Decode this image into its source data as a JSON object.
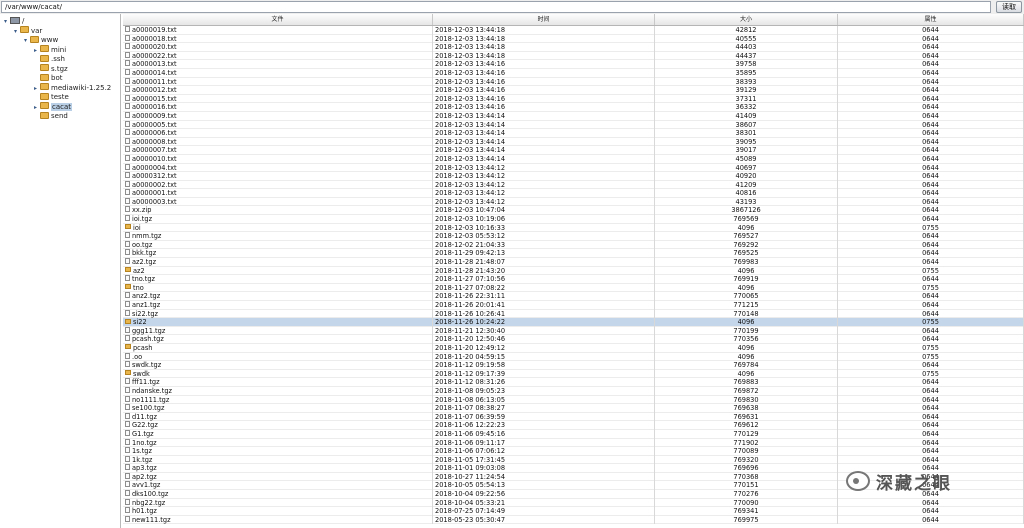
{
  "path_bar": {
    "value": "/var/www/cacat/",
    "read_label": "读取"
  },
  "tree": [
    {
      "label": "/",
      "depth": 0,
      "type": "root",
      "expanded": true
    },
    {
      "label": "var",
      "depth": 1,
      "type": "folder",
      "expanded": true
    },
    {
      "label": "www",
      "depth": 2,
      "type": "folder",
      "expanded": true
    },
    {
      "label": "mini",
      "depth": 3,
      "type": "folder",
      "expanded": false,
      "expandable": true
    },
    {
      "label": ".ssh",
      "depth": 3,
      "type": "folder"
    },
    {
      "label": "s.tgz",
      "depth": 3,
      "type": "folder"
    },
    {
      "label": "bot",
      "depth": 3,
      "type": "folder"
    },
    {
      "label": "mediawiki-1.25.2",
      "depth": 3,
      "type": "folder",
      "expanded": false,
      "expandable": true
    },
    {
      "label": "teste",
      "depth": 3,
      "type": "folder"
    },
    {
      "label": "cacat",
      "depth": 3,
      "type": "folder",
      "expanded": false,
      "expandable": true,
      "selected": true
    },
    {
      "label": "send",
      "depth": 3,
      "type": "folder"
    }
  ],
  "columns": [
    "文件",
    "时间",
    "大小",
    "属性"
  ],
  "files": [
    {
      "name": "a0000019.txt",
      "time": "2018-12-03 13:44:18",
      "size": "42812",
      "perm": "0644",
      "dir": false
    },
    {
      "name": "a0000018.txt",
      "time": "2018-12-03 13:44:18",
      "size": "40555",
      "perm": "0644",
      "dir": false
    },
    {
      "name": "a0000020.txt",
      "time": "2018-12-03 13:44:18",
      "size": "44403",
      "perm": "0644",
      "dir": false
    },
    {
      "name": "a0000022.txt",
      "time": "2018-12-03 13:44:18",
      "size": "44437",
      "perm": "0644",
      "dir": false
    },
    {
      "name": "a0000013.txt",
      "time": "2018-12-03 13:44:16",
      "size": "39758",
      "perm": "0644",
      "dir": false
    },
    {
      "name": "a0000014.txt",
      "time": "2018-12-03 13:44:16",
      "size": "35895",
      "perm": "0644",
      "dir": false
    },
    {
      "name": "a0000011.txt",
      "time": "2018-12-03 13:44:16",
      "size": "38393",
      "perm": "0644",
      "dir": false
    },
    {
      "name": "a0000012.txt",
      "time": "2018-12-03 13:44:16",
      "size": "39129",
      "perm": "0644",
      "dir": false
    },
    {
      "name": "a0000015.txt",
      "time": "2018-12-03 13:44:16",
      "size": "37311",
      "perm": "0644",
      "dir": false
    },
    {
      "name": "a0000016.txt",
      "time": "2018-12-03 13:44:16",
      "size": "36332",
      "perm": "0644",
      "dir": false
    },
    {
      "name": "a0000009.txt",
      "time": "2018-12-03 13:44:14",
      "size": "41409",
      "perm": "0644",
      "dir": false
    },
    {
      "name": "a0000005.txt",
      "time": "2018-12-03 13:44:14",
      "size": "38607",
      "perm": "0644",
      "dir": false
    },
    {
      "name": "a0000006.txt",
      "time": "2018-12-03 13:44:14",
      "size": "38301",
      "perm": "0644",
      "dir": false
    },
    {
      "name": "a0000008.txt",
      "time": "2018-12-03 13:44:14",
      "size": "39095",
      "perm": "0644",
      "dir": false
    },
    {
      "name": "a0000007.txt",
      "time": "2018-12-03 13:44:14",
      "size": "39017",
      "perm": "0644",
      "dir": false
    },
    {
      "name": "a0000010.txt",
      "time": "2018-12-03 13:44:14",
      "size": "45089",
      "perm": "0644",
      "dir": false
    },
    {
      "name": "a0000004.txt",
      "time": "2018-12-03 13:44:12",
      "size": "40697",
      "perm": "0644",
      "dir": false
    },
    {
      "name": "a0000312.txt",
      "time": "2018-12-03 13:44:12",
      "size": "40920",
      "perm": "0644",
      "dir": false
    },
    {
      "name": "a0000002.txt",
      "time": "2018-12-03 13:44:12",
      "size": "41209",
      "perm": "0644",
      "dir": false
    },
    {
      "name": "a0000001.txt",
      "time": "2018-12-03 13:44:12",
      "size": "40816",
      "perm": "0644",
      "dir": false
    },
    {
      "name": "a0000003.txt",
      "time": "2018-12-03 13:44:12",
      "size": "43193",
      "perm": "0644",
      "dir": false
    },
    {
      "name": "xx.zip",
      "time": "2018-12-03 10:47:04",
      "size": "3867126",
      "perm": "0644",
      "dir": false
    },
    {
      "name": "ioi.tgz",
      "time": "2018-12-03 10:19:06",
      "size": "769569",
      "perm": "0644",
      "dir": false
    },
    {
      "name": "ioi",
      "time": "2018-12-03 10:16:33",
      "size": "4096",
      "perm": "0755",
      "dir": true
    },
    {
      "name": "nmm.tgz",
      "time": "2018-12-03 05:53:12",
      "size": "769527",
      "perm": "0644",
      "dir": false
    },
    {
      "name": "oo.tgz",
      "time": "2018-12-02 21:04:33",
      "size": "769292",
      "perm": "0644",
      "dir": false
    },
    {
      "name": "bkk.tgz",
      "time": "2018-11-29 09:42:13",
      "size": "769525",
      "perm": "0644",
      "dir": false
    },
    {
      "name": "az2.tgz",
      "time": "2018-11-28 21:48:07",
      "size": "769983",
      "perm": "0644",
      "dir": false
    },
    {
      "name": "az2",
      "time": "2018-11-28 21:43:20",
      "size": "4096",
      "perm": "0755",
      "dir": true
    },
    {
      "name": "tno.tgz",
      "time": "2018-11-27 07:10:56",
      "size": "769919",
      "perm": "0644",
      "dir": false
    },
    {
      "name": "tno",
      "time": "2018-11-27 07:08:22",
      "size": "4096",
      "perm": "0755",
      "dir": true
    },
    {
      "name": "anz2.tgz",
      "time": "2018-11-26 22:31:11",
      "size": "770065",
      "perm": "0644",
      "dir": false
    },
    {
      "name": "anz1.tgz",
      "time": "2018-11-26 20:01:41",
      "size": "771215",
      "perm": "0644",
      "dir": false
    },
    {
      "name": "si22.tgz",
      "time": "2018-11-26 10:26:41",
      "size": "770148",
      "perm": "0644",
      "dir": false
    },
    {
      "name": "si22",
      "time": "2018-11-26 10:24:22",
      "size": "4096",
      "perm": "0755",
      "dir": true,
      "selected": true
    },
    {
      "name": "ggg11.tgz",
      "time": "2018-11-21 12:30:40",
      "size": "770199",
      "perm": "0644",
      "dir": false
    },
    {
      "name": "pcash.tgz",
      "time": "2018-11-20 12:50:46",
      "size": "770356",
      "perm": "0644",
      "dir": false
    },
    {
      "name": "pcash",
      "time": "2018-11-20 12:49:12",
      "size": "4096",
      "perm": "0755",
      "dir": true
    },
    {
      "name": ".oo",
      "time": "2018-11-20 04:59:15",
      "size": "4096",
      "perm": "0755",
      "dir": false
    },
    {
      "name": "swdk.tgz",
      "time": "2018-11-12 09:19:58",
      "size": "769784",
      "perm": "0644",
      "dir": false
    },
    {
      "name": "swdk",
      "time": "2018-11-12 09:17:39",
      "size": "4096",
      "perm": "0755",
      "dir": true
    },
    {
      "name": "fff11.tgz",
      "time": "2018-11-12 08:31:26",
      "size": "769883",
      "perm": "0644",
      "dir": false
    },
    {
      "name": "ndanske.tgz",
      "time": "2018-11-08 09:05:23",
      "size": "769872",
      "perm": "0644",
      "dir": false
    },
    {
      "name": "no1111.tgz",
      "time": "2018-11-08 06:13:05",
      "size": "769830",
      "perm": "0644",
      "dir": false
    },
    {
      "name": "se100.tgz",
      "time": "2018-11-07 08:38:27",
      "size": "769638",
      "perm": "0644",
      "dir": false
    },
    {
      "name": "d11.tgz",
      "time": "2018-11-07 06:39:59",
      "size": "769631",
      "perm": "0644",
      "dir": false
    },
    {
      "name": "G22.tgz",
      "time": "2018-11-06 12:22:23",
      "size": "769612",
      "perm": "0644",
      "dir": false
    },
    {
      "name": "G1.tgz",
      "time": "2018-11-06 09:45:16",
      "size": "770129",
      "perm": "0644",
      "dir": false
    },
    {
      "name": "1no.tgz",
      "time": "2018-11-06 09:11:17",
      "size": "771902",
      "perm": "0644",
      "dir": false
    },
    {
      "name": "1s.tgz",
      "time": "2018-11-06 07:06:12",
      "size": "770089",
      "perm": "0644",
      "dir": false
    },
    {
      "name": "1k.tgz",
      "time": "2018-11-05 17:31:45",
      "size": "769320",
      "perm": "0644",
      "dir": false
    },
    {
      "name": "ap3.tgz",
      "time": "2018-11-01 09:03:08",
      "size": "769696",
      "perm": "0644",
      "dir": false
    },
    {
      "name": "ap2.tgz",
      "time": "2018-10-27 11:24:54",
      "size": "770368",
      "perm": "0644",
      "dir": false
    },
    {
      "name": "avv1.tgz",
      "time": "2018-10-05 05:54:13",
      "size": "770151",
      "perm": "0644",
      "dir": false
    },
    {
      "name": "dks100.tgz",
      "time": "2018-10-04 09:22:56",
      "size": "770276",
      "perm": "0644",
      "dir": false
    },
    {
      "name": "nbg22.tgz",
      "time": "2018-10-04 05:33:21",
      "size": "770090",
      "perm": "0644",
      "dir": false
    },
    {
      "name": "h01.tgz",
      "time": "2018-07-25 07:14:49",
      "size": "769341",
      "perm": "0644",
      "dir": false
    },
    {
      "name": "new111.tgz",
      "time": "2018-05-23 05:30:47",
      "size": "769975",
      "perm": "0644",
      "dir": false
    }
  ],
  "watermark": {
    "text": "深藏之眼",
    "icon": "wechat-logo-icon"
  },
  "colors": {
    "selection": "#c4d6ea",
    "folder": "#e8b64a",
    "tree_selection": "#b9cfe6"
  }
}
